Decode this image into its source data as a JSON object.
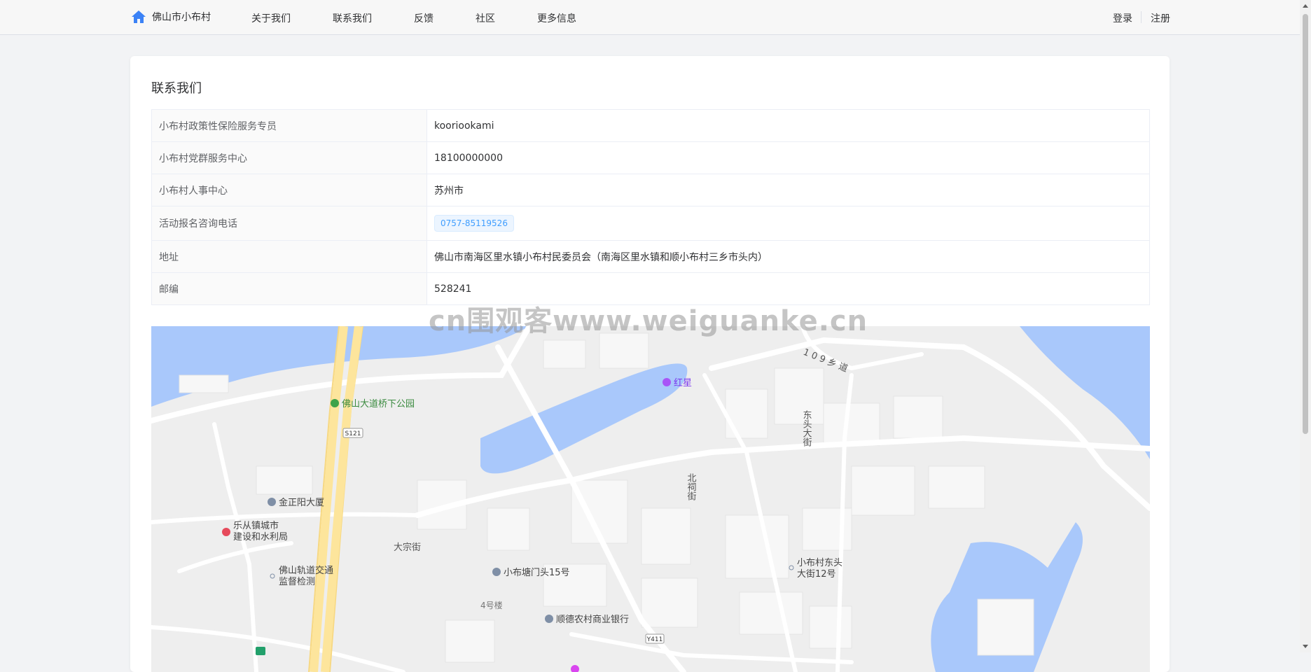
{
  "header": {
    "brand": "佛山市小布村",
    "nav": [
      "关于我们",
      "联系我们",
      "反馈",
      "社区",
      "更多信息"
    ],
    "login": "登录",
    "register": "注册"
  },
  "page": {
    "title": "联系我们",
    "rows": [
      {
        "label": "小布村政策性保险服务专员",
        "value": "kooriookami"
      },
      {
        "label": "小布村党群服务中心",
        "value": "18100000000"
      },
      {
        "label": "小布村人事中心",
        "value": "苏州市"
      },
      {
        "label": "活动报名咨询电话",
        "value": "0757-85119526"
      },
      {
        "label": "地址",
        "value": "佛山市南海区里水镇小布村民委员会（南海区里水镇和顺小布村三乡市头内）"
      },
      {
        "label": "邮编",
        "value": "528241"
      }
    ]
  },
  "map": {
    "labels": {
      "park": "佛山大道桥下公园",
      "road_s121": "S121",
      "hongxing": "红星",
      "road_109": "1 0 9 乡 道",
      "dongtou_st": "东头大街",
      "beici_st": "北祠街",
      "jinzhengyang": "金正阳大厦",
      "lecong_1": "乐从镇城市",
      "lecong_2": "建设和水利局",
      "metro_1": "佛山轨道交通",
      "metro_2": "监督检测",
      "dazong": "大宗街",
      "menlou": "小布塘门头15号",
      "bldg4": "4号楼",
      "bank": "顺德农村商业银行",
      "road_y411": "Y411",
      "xiaobu_1": "小布村东头",
      "xiaobu_2": "大街12号"
    },
    "colors": {
      "water": "#a9c8fb",
      "road": "#ffffff",
      "highway": "#fde59c",
      "ground": "#eeeeee"
    }
  },
  "watermark": "cn围观客www.weiguanke.cn"
}
